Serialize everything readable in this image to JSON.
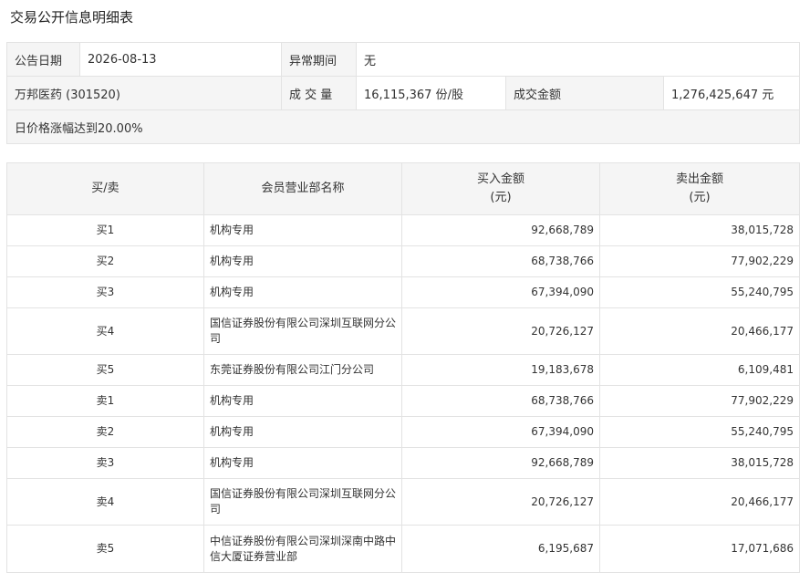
{
  "page": {
    "title": "交易公开信息明细表"
  },
  "info": {
    "date_label": "公告日期",
    "date_value": "2026-08-13",
    "period_label": "异常期间",
    "period_value": "无",
    "stock": "万邦医药 (301520)",
    "volume_label": "成 交 量",
    "volume_value": "16,115,367 份/股",
    "amount_label": "成交金额",
    "amount_value": "1,276,425,647 元",
    "reason": "日价格涨幅达到20.00%"
  },
  "table": {
    "headers": {
      "side": "买/卖",
      "name": "会员营业部名称",
      "buy_line1": "买入金额",
      "buy_line2": "(元)",
      "sell_line1": "卖出金额",
      "sell_line2": "(元)"
    },
    "rows": [
      {
        "side": "买1",
        "name": "机构专用",
        "buy": "92,668,789",
        "sell": "38,015,728"
      },
      {
        "side": "买2",
        "name": "机构专用",
        "buy": "68,738,766",
        "sell": "77,902,229"
      },
      {
        "side": "买3",
        "name": "机构专用",
        "buy": "67,394,090",
        "sell": "55,240,795"
      },
      {
        "side": "买4",
        "name": "国信证券股份有限公司深圳互联网分公司",
        "buy": "20,726,127",
        "sell": "20,466,177"
      },
      {
        "side": "买5",
        "name": "东莞证券股份有限公司江门分公司",
        "buy": "19,183,678",
        "sell": "6,109,481"
      },
      {
        "side": "卖1",
        "name": "机构专用",
        "buy": "68,738,766",
        "sell": "77,902,229"
      },
      {
        "side": "卖2",
        "name": "机构专用",
        "buy": "67,394,090",
        "sell": "55,240,795"
      },
      {
        "side": "卖3",
        "name": "机构专用",
        "buy": "92,668,789",
        "sell": "38,015,728"
      },
      {
        "side": "卖4",
        "name": "国信证券股份有限公司深圳互联网分公司",
        "buy": "20,726,127",
        "sell": "20,466,177"
      },
      {
        "side": "卖5",
        "name": "中信证券股份有限公司深圳深南中路中信大厦证券营业部",
        "buy": "6,195,687",
        "sell": "17,071,686"
      }
    ]
  }
}
